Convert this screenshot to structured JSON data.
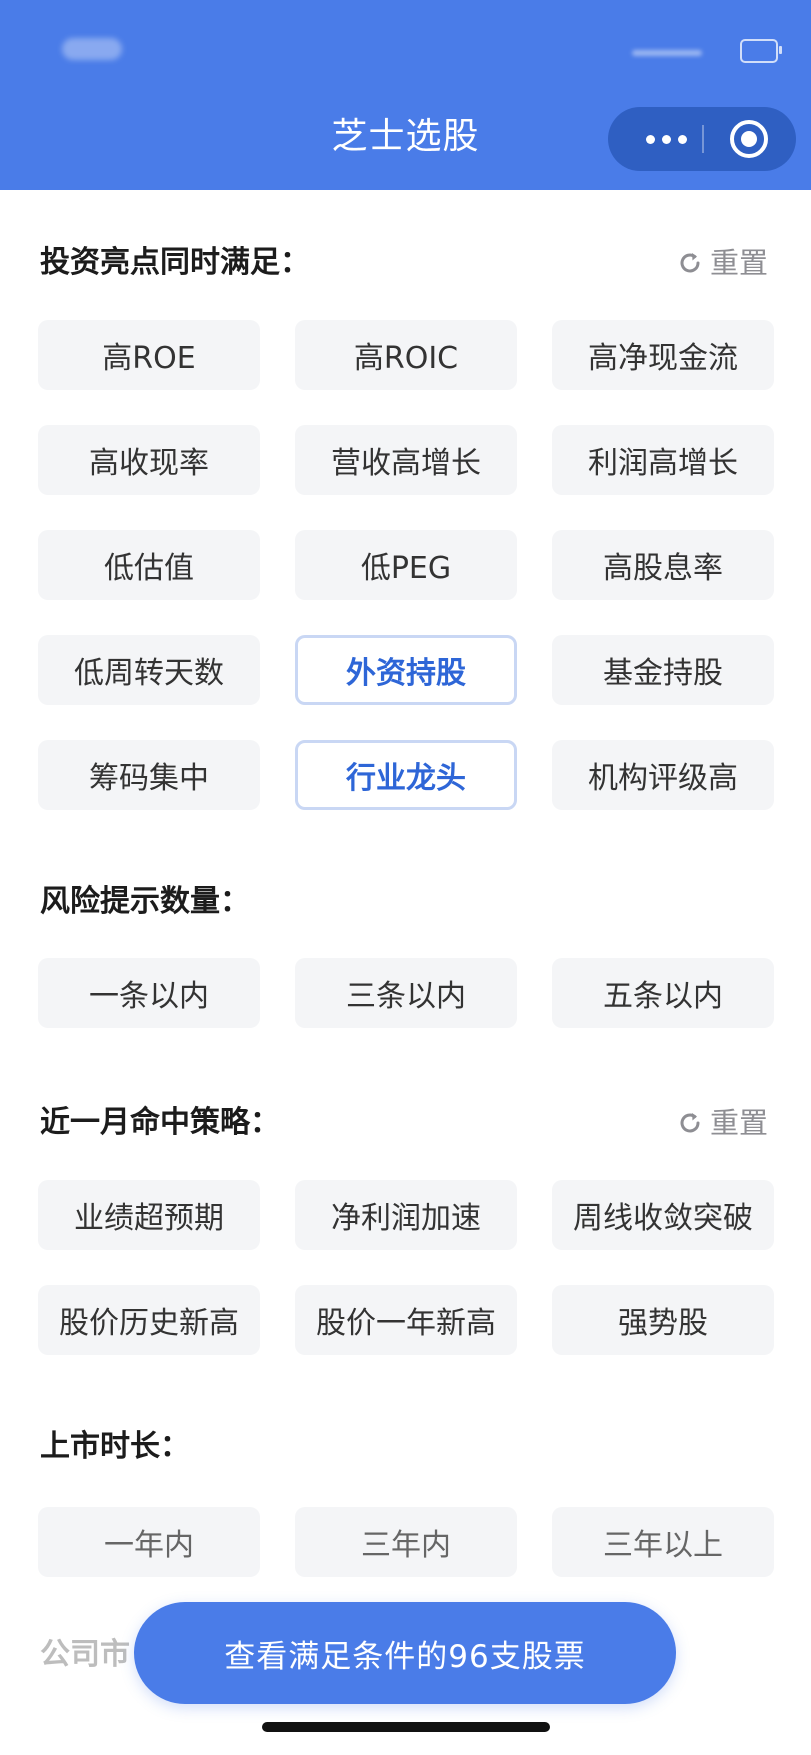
{
  "header": {
    "title": "芝士选股",
    "bg_color": "#4a7ce8",
    "more_icon": "more-dots-icon",
    "close_icon": "target-close-icon"
  },
  "sections": {
    "highlights": {
      "title": "投资亮点同时满足：",
      "reset_label": "重置",
      "chips": [
        {
          "label": "高ROE",
          "selected": false
        },
        {
          "label": "高ROIC",
          "selected": false
        },
        {
          "label": "高净现金流",
          "selected": false
        },
        {
          "label": "高收现率",
          "selected": false
        },
        {
          "label": "营收高增长",
          "selected": false
        },
        {
          "label": "利润高增长",
          "selected": false
        },
        {
          "label": "低估值",
          "selected": false
        },
        {
          "label": "低PEG",
          "selected": false
        },
        {
          "label": "高股息率",
          "selected": false
        },
        {
          "label": "低周转天数",
          "selected": false
        },
        {
          "label": "外资持股",
          "selected": true
        },
        {
          "label": "基金持股",
          "selected": false
        },
        {
          "label": "筹码集中",
          "selected": false
        },
        {
          "label": "行业龙头",
          "selected": true
        },
        {
          "label": "机构评级高",
          "selected": false
        }
      ]
    },
    "risk": {
      "title": "风险提示数量：",
      "chips": [
        {
          "label": "一条以内"
        },
        {
          "label": "三条以内"
        },
        {
          "label": "五条以内"
        }
      ]
    },
    "strategy": {
      "title": "近一月命中策略：",
      "reset_label": "重置",
      "chips": [
        {
          "label": "业绩超预期"
        },
        {
          "label": "净利润加速"
        },
        {
          "label": "周线收敛突破"
        },
        {
          "label": "股价历史新高"
        },
        {
          "label": "股价一年新高"
        },
        {
          "label": "强势股"
        }
      ]
    },
    "listing": {
      "title": "上市时长：",
      "chips": [
        {
          "label": "一年内"
        },
        {
          "label": "三年内"
        },
        {
          "label": "三年以上"
        }
      ]
    },
    "partial": {
      "title": "公司市"
    }
  },
  "cta": {
    "label": "查看满足条件的96支股票"
  },
  "colors": {
    "accent": "#4a7ce8",
    "selected_text": "#2e66d7",
    "selected_border": "#c9d7f4",
    "chip_bg": "#f4f5f7"
  }
}
